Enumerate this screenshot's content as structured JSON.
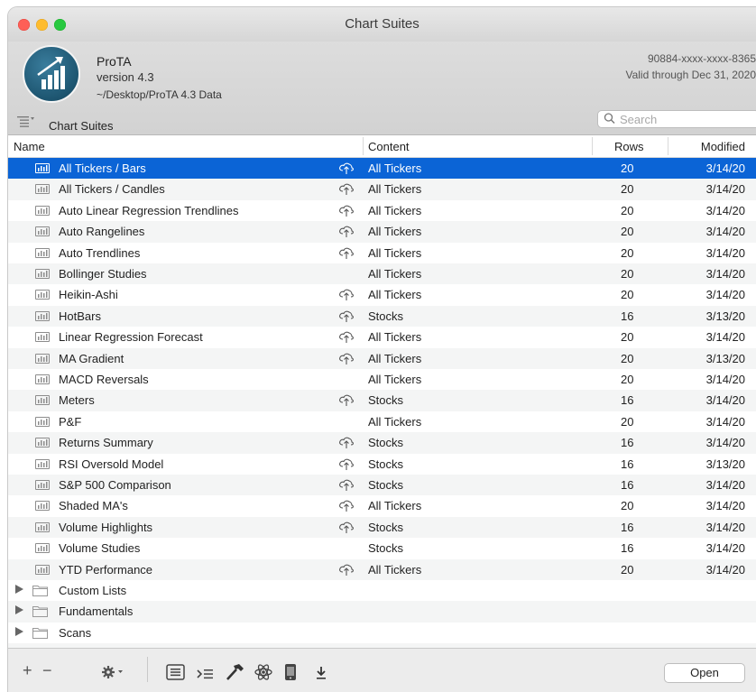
{
  "window": {
    "title": "Chart Suites"
  },
  "header": {
    "app_name": "ProTA",
    "version": "version 4.3",
    "data_path": "~/Desktop/ProTA 4.3 Data",
    "serial": "90884-xxxx-xxxx-8365",
    "validity": "Valid through Dec 31, 2020",
    "section_label": "Chart Suites",
    "search_placeholder": "Search"
  },
  "table": {
    "columns": {
      "name": "Name",
      "content": "Content",
      "rows": "Rows",
      "modified": "Modified"
    },
    "suites": [
      {
        "name": "All Tickers / Bars",
        "cloud": true,
        "content": "All Tickers",
        "rows": "20",
        "modified": "3/14/20",
        "selected": true
      },
      {
        "name": "All Tickers / Candles",
        "cloud": true,
        "content": "All Tickers",
        "rows": "20",
        "modified": "3/14/20"
      },
      {
        "name": "Auto Linear Regression Trendlines",
        "cloud": true,
        "content": "All Tickers",
        "rows": "20",
        "modified": "3/14/20"
      },
      {
        "name": "Auto Rangelines",
        "cloud": true,
        "content": "All Tickers",
        "rows": "20",
        "modified": "3/14/20"
      },
      {
        "name": "Auto Trendlines",
        "cloud": true,
        "content": "All Tickers",
        "rows": "20",
        "modified": "3/14/20"
      },
      {
        "name": "Bollinger Studies",
        "cloud": false,
        "content": "All Tickers",
        "rows": "20",
        "modified": "3/14/20"
      },
      {
        "name": "Heikin-Ashi",
        "cloud": true,
        "content": "All Tickers",
        "rows": "20",
        "modified": "3/14/20"
      },
      {
        "name": "HotBars",
        "cloud": true,
        "content": "Stocks",
        "rows": "16",
        "modified": "3/13/20"
      },
      {
        "name": "Linear Regression Forecast",
        "cloud": true,
        "content": "All Tickers",
        "rows": "20",
        "modified": "3/14/20"
      },
      {
        "name": "MA Gradient",
        "cloud": true,
        "content": "All Tickers",
        "rows": "20",
        "modified": "3/13/20"
      },
      {
        "name": "MACD Reversals",
        "cloud": false,
        "content": "All Tickers",
        "rows": "20",
        "modified": "3/14/20"
      },
      {
        "name": "Meters",
        "cloud": true,
        "content": "Stocks",
        "rows": "16",
        "modified": "3/14/20"
      },
      {
        "name": "P&F",
        "cloud": false,
        "content": "All Tickers",
        "rows": "20",
        "modified": "3/14/20"
      },
      {
        "name": "Returns Summary",
        "cloud": true,
        "content": "Stocks",
        "rows": "16",
        "modified": "3/14/20"
      },
      {
        "name": "RSI Oversold Model",
        "cloud": true,
        "content": "Stocks",
        "rows": "16",
        "modified": "3/13/20"
      },
      {
        "name": "S&P 500 Comparison",
        "cloud": true,
        "content": "Stocks",
        "rows": "16",
        "modified": "3/14/20"
      },
      {
        "name": "Shaded MA's",
        "cloud": true,
        "content": "All Tickers",
        "rows": "20",
        "modified": "3/14/20"
      },
      {
        "name": "Volume Highlights",
        "cloud": true,
        "content": "Stocks",
        "rows": "16",
        "modified": "3/14/20"
      },
      {
        "name": "Volume Studies",
        "cloud": false,
        "content": "Stocks",
        "rows": "16",
        "modified": "3/14/20"
      },
      {
        "name": "YTD Performance",
        "cloud": true,
        "content": "All Tickers",
        "rows": "20",
        "modified": "3/14/20"
      }
    ],
    "folders": [
      {
        "name": "Custom Lists"
      },
      {
        "name": "Fundamentals"
      },
      {
        "name": "Scans"
      }
    ]
  },
  "bottom_bar": {
    "add_label": "+",
    "remove_label": "−",
    "open_label": "Open"
  },
  "icons": {
    "chart": "chart-icon",
    "cloud": "cloud-upload-icon",
    "folder": "folder-icon",
    "gear": "gear-icon",
    "list": "list-icon",
    "indent": "indent-icon",
    "hammer": "hammer-icon",
    "atom": "atom-icon",
    "phone": "phone-icon",
    "download": "download-icon"
  },
  "colors": {
    "selection": "#0b64d6",
    "logo": "#1d5570"
  }
}
